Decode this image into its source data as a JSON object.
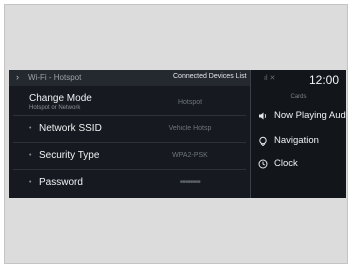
{
  "header": {
    "title": "Wi-Fi - Hotspot",
    "tab_connected_devices": "Connected Devices List"
  },
  "settings": {
    "change_mode": {
      "label": "Change Mode",
      "sublabel": "Hotspot or Network",
      "value": "Hotspot"
    },
    "network_ssid": {
      "label": "Network SSID",
      "value": "Vehicle Hotsp"
    },
    "security_type": {
      "label": "Security Type",
      "value": "WPA2-PSK"
    },
    "password": {
      "label": "Password",
      "value": "■■■■■■■■"
    }
  },
  "right_panel": {
    "clock": "12:00",
    "cards_title": "Cards",
    "items": [
      {
        "label": "Now Playing Aud",
        "icon": "speaker-icon"
      },
      {
        "label": "Navigation",
        "icon": "map-pin-icon"
      },
      {
        "label": "Clock",
        "icon": "clock-icon"
      }
    ]
  },
  "colors": {
    "screen_bg": "#161a20",
    "header_bg": "#24282f",
    "text_primary": "#f0f2f5",
    "text_muted": "#6e747d"
  }
}
